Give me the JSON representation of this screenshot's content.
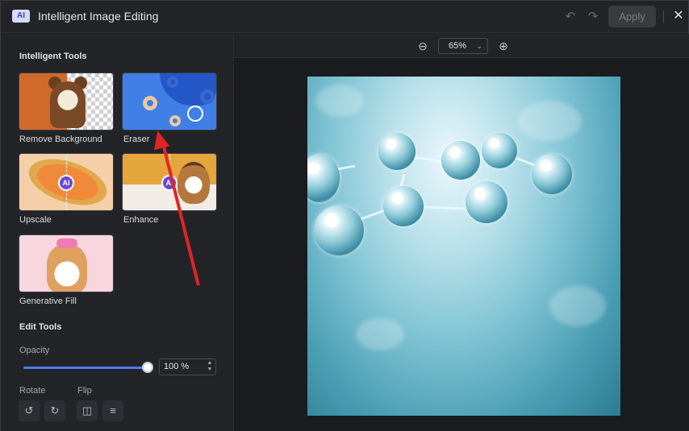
{
  "titlebar": {
    "logo_text": "AI",
    "title": "Intelligent Image Editing",
    "undo_icon": "undo-icon",
    "redo_icon": "redo-icon",
    "apply_label": "Apply",
    "close_icon": "close-icon"
  },
  "intelligent_tools": {
    "title": "Intelligent Tools",
    "items": [
      {
        "label": "Remove Background"
      },
      {
        "label": "Eraser"
      },
      {
        "label": "Upscale",
        "badge": "AI"
      },
      {
        "label": "Enhance",
        "badge": "AI"
      },
      {
        "label": "Generative Fill"
      }
    ]
  },
  "edit_tools": {
    "title": "Edit Tools",
    "opacity_label": "Opacity",
    "opacity_value": "100 %",
    "opacity_level": 1.0,
    "rotate_label": "Rotate",
    "flip_label": "Flip",
    "accent_color": "#4a7dff"
  },
  "canvas": {
    "zoom_value": "65%"
  },
  "annotation": {
    "arrow_color": "#e02525"
  }
}
